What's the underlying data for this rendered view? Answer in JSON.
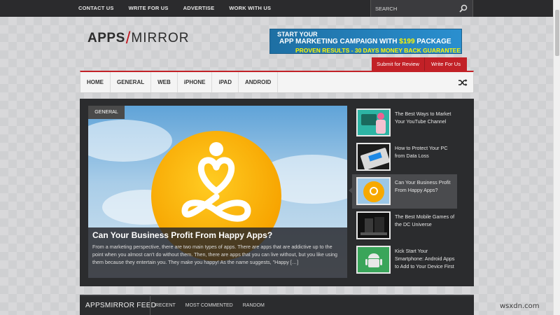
{
  "topnav": [
    "CONTACT US",
    "WRITE FOR US",
    "ADVERTISE",
    "WORK WITH US"
  ],
  "search": {
    "placeholder": "SEARCH",
    "icon": "search-icon"
  },
  "logo": {
    "apps": "APPS",
    "slash": "/",
    "mirror": "MIRROR"
  },
  "banner": {
    "line1": "START YOUR",
    "line2_pre": "APP MARKETING CAMPAIGN WITH ",
    "line2_price": "$199",
    "line2_post": " PACKAGE",
    "line3": "PROVEN RESULTS - 30 DAYS MONEY BACK GUARANTEE"
  },
  "actions": {
    "submit": "Submit for Review",
    "write": "Write For Us"
  },
  "mainnav": [
    "HOME",
    "GENERAL",
    "WEB",
    "iPHONE",
    "iPAD",
    "ANDROID"
  ],
  "featured": {
    "category": "GENERAL",
    "title": "Can Your Business Profit From Happy Apps?",
    "excerpt": "From a marketing perspective, there are two main types of apps. There are apps that are addictive up to the point when you almost can't do without them. Then, there are apps that you can live without, but you like using them because they entertain you. They make you happy! As the name suggests, \"Happy […]"
  },
  "sidelist": [
    {
      "title": "The Best Ways to Market Your YouTube Channel"
    },
    {
      "title": "How to Protect Your PC from Data Loss"
    },
    {
      "title": "Can Your Business Profit From Happy Apps?"
    },
    {
      "title": "The Best Mobile Games of the DC Universe"
    },
    {
      "title": "Kick Start Your Smartphone: Android Apps to Add to Your Device First"
    }
  ],
  "feed": {
    "title": "APPSMIRROR FEED",
    "tabs": [
      "RECENT",
      "MOST COMMENTED",
      "RANDOM"
    ]
  },
  "watermark": "wsxdn.com",
  "colors": {
    "accent": "#c22127",
    "banner_blue": "#2a8fcf",
    "banner_yellow": "#fff600",
    "dark_panel": "#2b2c2e"
  }
}
